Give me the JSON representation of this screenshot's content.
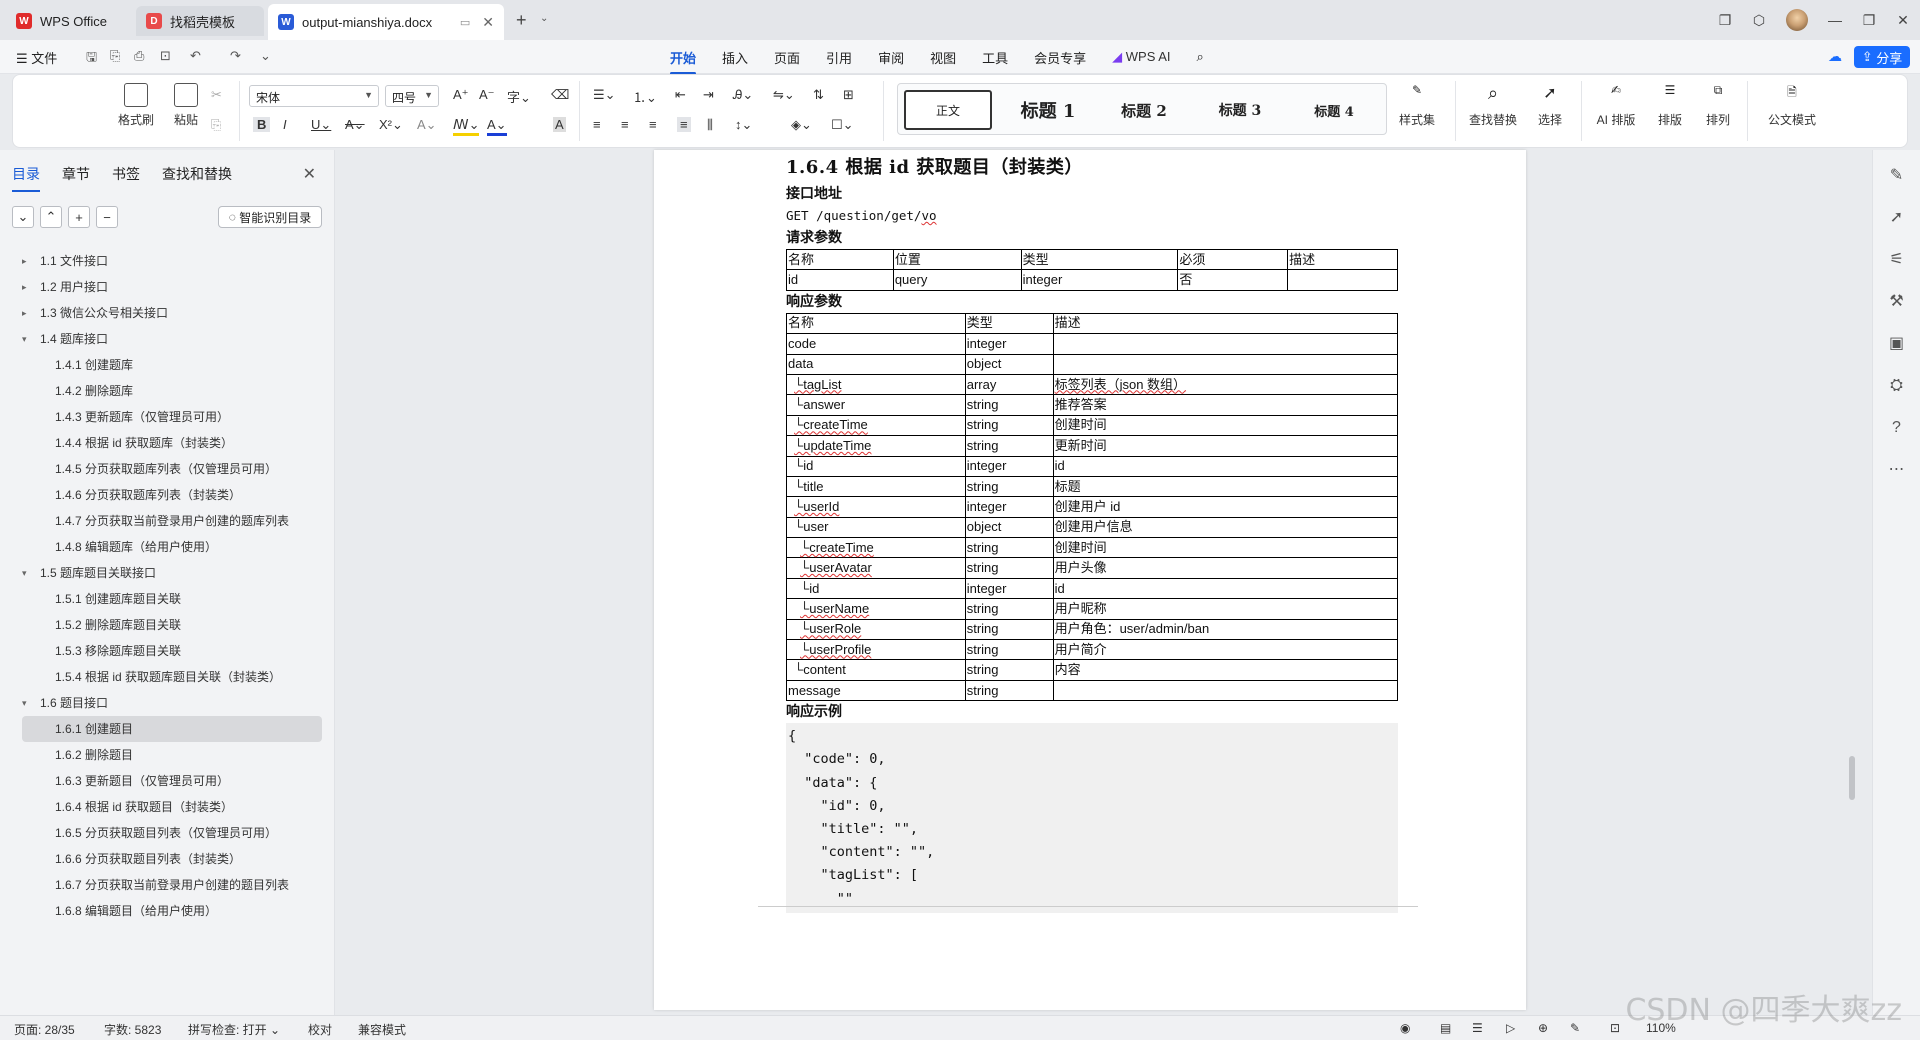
{
  "tabs": [
    {
      "label": "WPS Office"
    },
    {
      "label": "找稻壳模板"
    },
    {
      "label": "output-mianshiya.docx"
    }
  ],
  "menu": {
    "file": "文件",
    "tabs": [
      "开始",
      "插入",
      "页面",
      "引用",
      "审阅",
      "视图",
      "工具",
      "会员专享",
      "WPS AI"
    ],
    "active": "开始",
    "share": "分享"
  },
  "ribbon": {
    "format_painter": "格式刷",
    "paste": "粘贴",
    "font_name": "宋体",
    "font_size": "四号",
    "styles": [
      "正文",
      "标题 1",
      "标题 2",
      "标题 3",
      "标题 4"
    ],
    "style_set": "样式集",
    "find_replace": "查找替换",
    "select": "选择",
    "ai_layout": "AI 排版",
    "layout": "排版",
    "arrange": "排列",
    "official_mode": "公文模式"
  },
  "nav": {
    "tabs": [
      "目录",
      "章节",
      "书签",
      "查找和替换"
    ],
    "smart_toc": "智能识别目录",
    "items": [
      {
        "text": "1.1 文件接口",
        "level": 1,
        "arrow": "▸"
      },
      {
        "text": "1.2 用户接口",
        "level": 1,
        "arrow": "▸"
      },
      {
        "text": "1.3 微信公众号相关接口",
        "level": 1,
        "arrow": "▸"
      },
      {
        "text": "1.4 题库接口",
        "level": 1,
        "arrow": "▾"
      },
      {
        "text": "1.4.1 创建题库",
        "level": 2
      },
      {
        "text": "1.4.2 删除题库",
        "level": 2
      },
      {
        "text": "1.4.3 更新题库（仅管理员可用）",
        "level": 2
      },
      {
        "text": "1.4.4 根据 id 获取题库（封装类）",
        "level": 2
      },
      {
        "text": "1.4.5 分页获取题库列表（仅管理员可用）",
        "level": 2
      },
      {
        "text": "1.4.6 分页获取题库列表（封装类）",
        "level": 2
      },
      {
        "text": "1.4.7 分页获取当前登录用户创建的题库列表",
        "level": 2
      },
      {
        "text": "1.4.8 编辑题库（给用户使用）",
        "level": 2
      },
      {
        "text": "1.5 题库题目关联接口",
        "level": 1,
        "arrow": "▾"
      },
      {
        "text": "1.5.1 创建题库题目关联",
        "level": 2
      },
      {
        "text": "1.5.2 删除题库题目关联",
        "level": 2
      },
      {
        "text": "1.5.3 移除题库题目关联",
        "level": 2
      },
      {
        "text": "1.5.4 根据 id 获取题库题目关联（封装类）",
        "level": 2
      },
      {
        "text": "1.6 题目接口",
        "level": 1,
        "arrow": "▾"
      },
      {
        "text": "1.6.1 创建题目",
        "level": 2,
        "selected": true
      },
      {
        "text": "1.6.2 删除题目",
        "level": 2
      },
      {
        "text": "1.6.3 更新题目（仅管理员可用）",
        "level": 2
      },
      {
        "text": "1.6.4 根据 id 获取题目（封装类）",
        "level": 2
      },
      {
        "text": "1.6.5 分页获取题目列表（仅管理员可用）",
        "level": 2
      },
      {
        "text": "1.6.6 分页获取题目列表（封装类）",
        "level": 2
      },
      {
        "text": "1.6.7 分页获取当前登录用户创建的题目列表",
        "level": 2
      },
      {
        "text": "1.6.8 编辑题目（给用户使用）",
        "level": 2
      }
    ]
  },
  "doc": {
    "heading": "1.6.4 根据 id 获取题目（封装类）",
    "api_addr_label": "接口地址",
    "api_addr": "GET /question/get/vo",
    "req_params_label": "请求参数",
    "req_headers": [
      "名称",
      "位置",
      "类型",
      "必须",
      "描述"
    ],
    "req_rows": [
      [
        "id",
        "query",
        "integer",
        "否",
        ""
      ]
    ],
    "resp_params_label": "响应参数",
    "resp_headers": [
      "名称",
      "类型",
      "描述"
    ],
    "resp_rows": [
      [
        "code",
        "integer",
        ""
      ],
      [
        "data",
        "object",
        ""
      ],
      [
        "└tagList",
        "array",
        "标签列表（json 数组）"
      ],
      [
        "└answer",
        "string",
        "推荐答案"
      ],
      [
        "└createTime",
        "string",
        "创建时间"
      ],
      [
        "└updateTime",
        "string",
        "更新时间"
      ],
      [
        "└id",
        "integer",
        "id"
      ],
      [
        "└title",
        "string",
        "标题"
      ],
      [
        "└userId",
        "integer",
        "创建用户 id"
      ],
      [
        "└user",
        "object",
        "创建用户信息"
      ],
      [
        "└createTime",
        "string",
        "创建时间"
      ],
      [
        "└userAvatar",
        "string",
        "用户头像"
      ],
      [
        "└id",
        "integer",
        "id"
      ],
      [
        "└userName",
        "string",
        "用户昵称"
      ],
      [
        "└userRole",
        "string",
        "用户角色：user/admin/ban"
      ],
      [
        "└userProfile",
        "string",
        "用户简介"
      ],
      [
        "└content",
        "string",
        "内容"
      ],
      [
        "message",
        "string",
        ""
      ]
    ],
    "resp_example_label": "响应示例",
    "code_lines": [
      "{",
      "  \"code\": 0,",
      "  \"data\": {",
      "    \"id\": 0,",
      "    \"title\": \"\",",
      "    \"content\": \"\",",
      "    \"tagList\": [",
      "      \"\""
    ]
  },
  "status": {
    "page": "页面: 28/35",
    "words": "字数: 5823",
    "spell": "拼写检查: 打开",
    "proof": "校对",
    "compat": "兼容模式",
    "zoom": "110%"
  },
  "watermark": "CSDN @四季大爽zz"
}
